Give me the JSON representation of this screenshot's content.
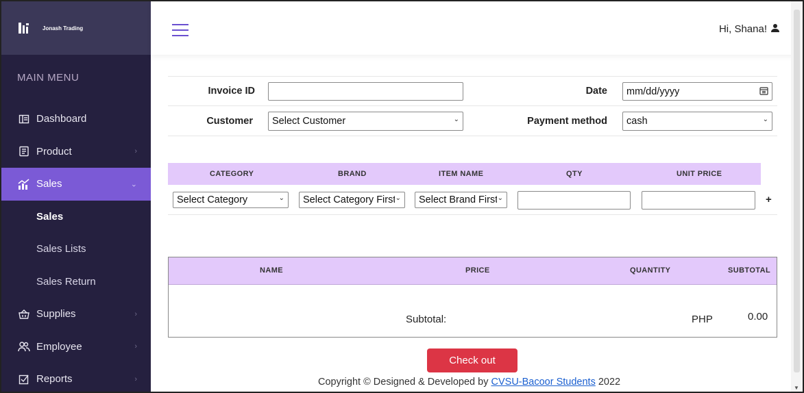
{
  "brand": {
    "name": "Jonash Trading"
  },
  "sidebar": {
    "menu_title": "MAIN MENU",
    "items": [
      {
        "label": "Dashboard",
        "icon": "dashboard-icon"
      },
      {
        "label": "Product",
        "icon": "product-icon"
      },
      {
        "label": "Sales",
        "icon": "sales-icon",
        "active": true
      },
      {
        "label": "Supplies",
        "icon": "basket-icon"
      },
      {
        "label": "Employee",
        "icon": "users-icon"
      },
      {
        "label": "Reports",
        "icon": "reports-icon"
      }
    ],
    "sales_sub": [
      "Sales",
      "Sales Lists",
      "Sales Return"
    ]
  },
  "header": {
    "greeting": "Hi, Shana!"
  },
  "form": {
    "invoice_label": "Invoice ID",
    "invoice_value": "",
    "date_label": "Date",
    "date_placeholder": "mm/dd/yyyy",
    "customer_label": "Customer",
    "customer_selected": "Select Customer",
    "payment_label": "Payment method",
    "payment_selected": "cash"
  },
  "item_table": {
    "headers": [
      "CATEGORY",
      "BRAND",
      "ITEM NAME",
      "QTY",
      "UNIT PRICE"
    ],
    "category_selected": "Select Category",
    "brand_selected": "Select Category First",
    "item_selected": "Select Brand First",
    "qty_value": "",
    "unit_price_value": "",
    "add_label": "+"
  },
  "cart": {
    "headers": [
      "NAME",
      "PRICE",
      "QUANTITY",
      "SUBTOTAL"
    ],
    "subtotal_label": "Subtotal:",
    "currency": "PHP",
    "subtotal_value": "0.00"
  },
  "checkout_label": "Check out",
  "footer": {
    "prefix": "Copyright © Designed & Developed by",
    "link": "CVSU-Bacoor Students",
    "year": "2022"
  },
  "colors": {
    "sidebar_bg": "#25203f",
    "brand_bg": "#3b3858",
    "active_nav": "#7b5ad6",
    "table_header": "#e3c9fb",
    "checkout": "#dc3545"
  }
}
